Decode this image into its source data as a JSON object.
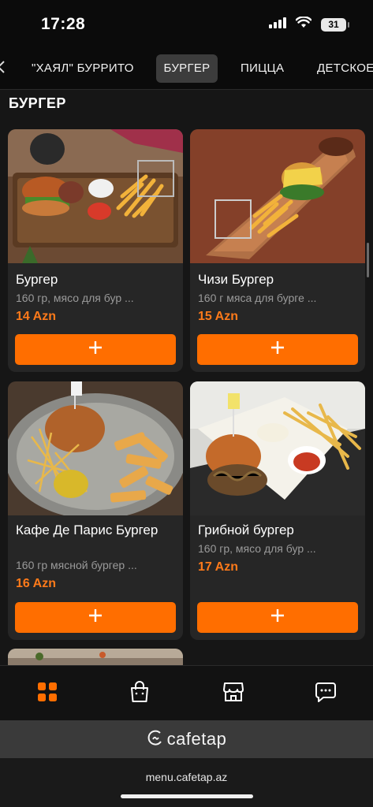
{
  "status_bar": {
    "time": "17:28",
    "battery": "31"
  },
  "tabs": [
    {
      "label": "\"ХАЯЛ\" БУРРИТО",
      "active": false
    },
    {
      "label": "БУРГЕР",
      "active": true
    },
    {
      "label": "ПИЦЦА",
      "active": false
    },
    {
      "label": "ДЕТСКОЕ",
      "active": false
    }
  ],
  "section": {
    "title": "БУРГЕР"
  },
  "products": [
    {
      "name": "Бургер",
      "description": "160 гр, мясо для бур ...",
      "price": "14 Azn",
      "add_label": "+"
    },
    {
      "name": "Чизи Бургер",
      "description": "160 г мяса для бурге ...",
      "price": "15 Azn",
      "add_label": "+"
    },
    {
      "name": "Кафе Де Парис Бургер",
      "description": "160 гр мясной бургер ...",
      "price": "16 Azn",
      "add_label": "+"
    },
    {
      "name": "Грибной бургер",
      "description": "160 гр, мясо для бур ...",
      "price": "17 Azn",
      "add_label": "+"
    }
  ],
  "bottom_nav": [
    {
      "icon": "grid-icon",
      "active": true
    },
    {
      "icon": "shopping-bag-icon",
      "active": false
    },
    {
      "icon": "store-icon",
      "active": false
    },
    {
      "icon": "chat-icon",
      "active": false
    }
  ],
  "brand": {
    "name": "cafetap"
  },
  "browser": {
    "url": "menu.cafetap.az"
  },
  "colors": {
    "accent": "#ff6e00",
    "price": "#ff7a1a",
    "background": "#161616",
    "card": "#262626"
  }
}
